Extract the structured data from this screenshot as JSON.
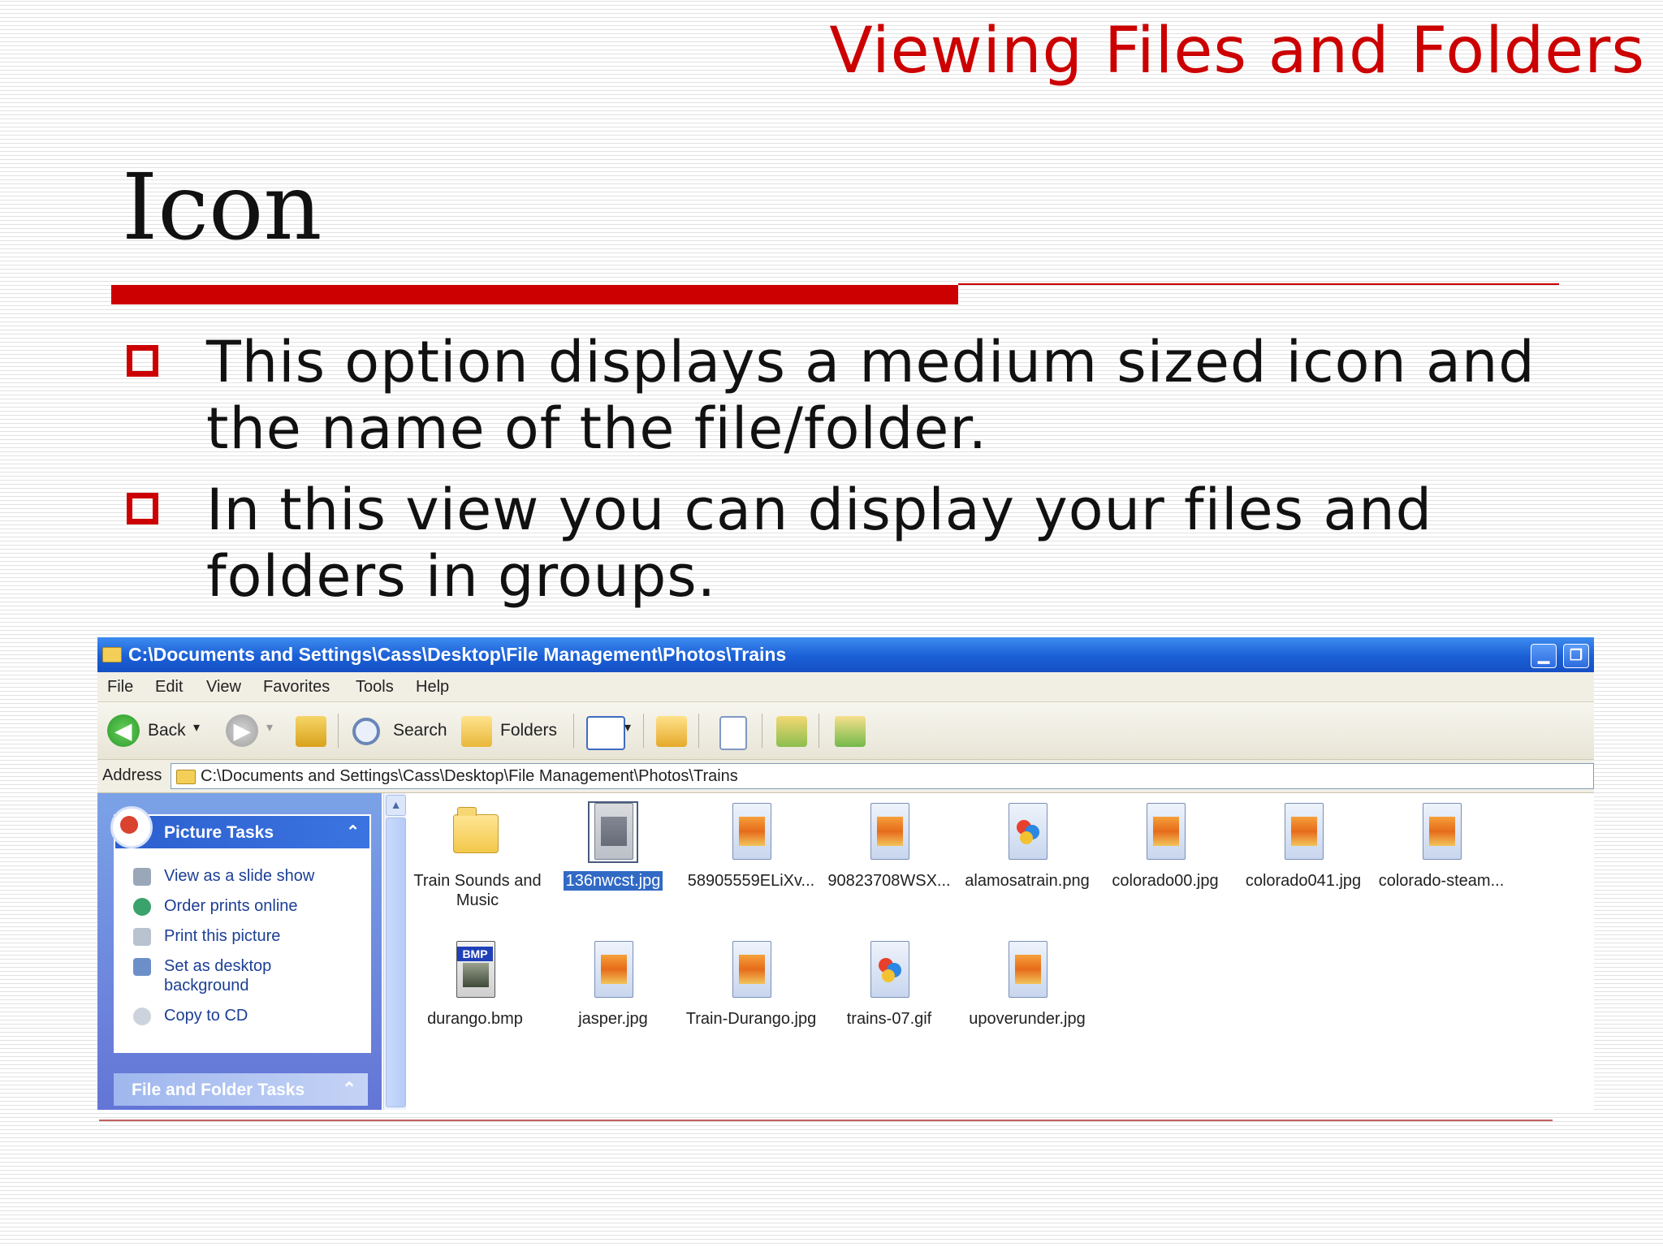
{
  "slide": {
    "title": "Viewing Files and Folders",
    "heading": "Icon",
    "bullets": [
      "This option displays a medium sized icon and the name of the file/folder.",
      "In this view you can display your files and folders in groups."
    ],
    "accent_color": "#cc0000"
  },
  "window": {
    "title": "C:\\Documents and Settings\\Cass\\Desktop\\File Management\\Photos\\Trains",
    "minimize_glyph": "▁",
    "restore_glyph": "❐",
    "menu": [
      "File",
      "Edit",
      "View",
      "Favorites",
      "Tools",
      "Help"
    ],
    "toolbar": {
      "back_label": "Back",
      "back_glyph": "◀",
      "forward_glyph": "▶",
      "dropdown_glyph": "▾",
      "search_label": "Search",
      "folders_label": "Folders"
    },
    "address": {
      "label": "Address",
      "value": "C:\\Documents and Settings\\Cass\\Desktop\\File Management\\Photos\\Trains"
    },
    "task_pane": {
      "picture_tasks_title": "Picture Tasks",
      "collapse_glyph": "⌃",
      "tasks": [
        "View as a slide show",
        "Order prints online",
        "Print this picture",
        "Set as desktop background",
        "Copy to CD"
      ],
      "file_folder_tasks_title": "File and Folder Tasks"
    },
    "scroll_up_glyph": "▲",
    "bmp_badge": "BMP",
    "files": [
      {
        "name": "Train Sounds and Music",
        "type": "folder",
        "selected": false
      },
      {
        "name": "136nwcst.jpg",
        "type": "jpg",
        "selected": true
      },
      {
        "name": "58905559ELiXv...",
        "type": "jpg",
        "selected": false
      },
      {
        "name": "90823708WSX...",
        "type": "jpg",
        "selected": false
      },
      {
        "name": "alamosatrain.png",
        "type": "png",
        "selected": false
      },
      {
        "name": "colorado00.jpg",
        "type": "jpg",
        "selected": false
      },
      {
        "name": "colorado041.jpg",
        "type": "jpg",
        "selected": false
      },
      {
        "name": "colorado-steam...",
        "type": "jpg",
        "selected": false
      },
      {
        "name": "durango.bmp",
        "type": "bmp",
        "selected": false
      },
      {
        "name": "jasper.jpg",
        "type": "jpg",
        "selected": false
      },
      {
        "name": "Train-Durango.jpg",
        "type": "jpg",
        "selected": false
      },
      {
        "name": "trains-07.gif",
        "type": "gif",
        "selected": false
      },
      {
        "name": "upoverunder.jpg",
        "type": "jpg",
        "selected": false
      }
    ]
  }
}
